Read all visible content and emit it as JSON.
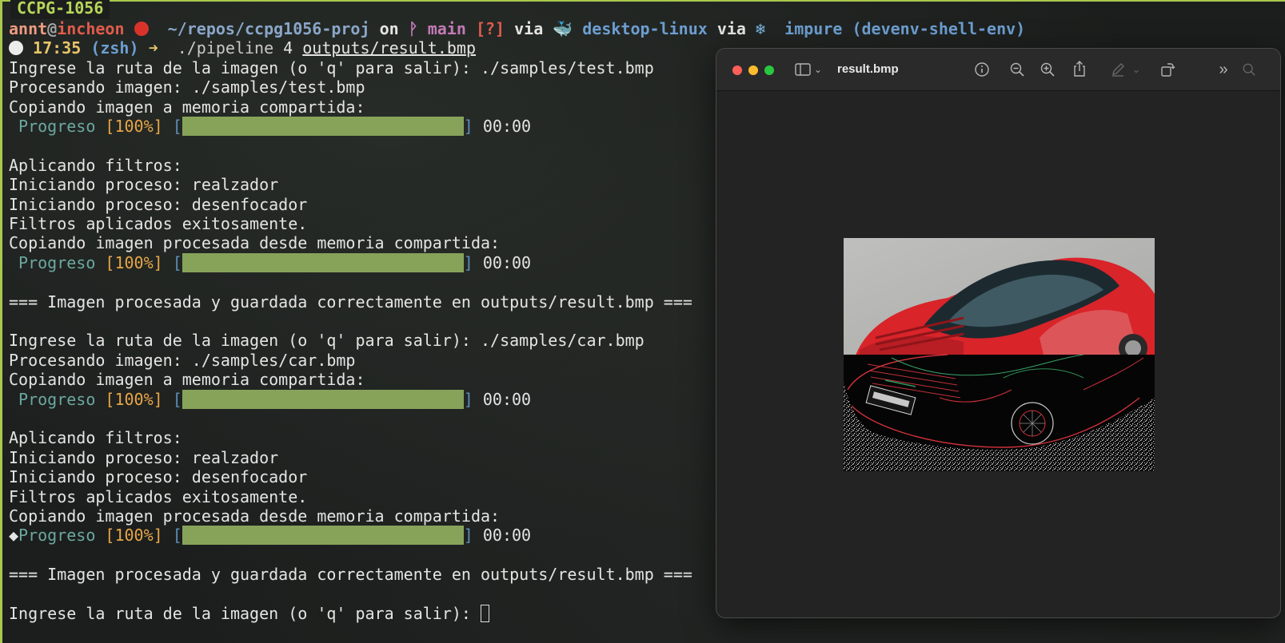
{
  "terminal": {
    "tab_title": "CCPG-1056",
    "prompt1": {
      "user": "annt",
      "at": "@",
      "host": "incheon",
      "path": "~/repos/ccpg1056-proj",
      "on": " on ",
      "branch": "main",
      "status": "[?]",
      "via1": " via ",
      "context": "desktop-linux",
      "via2": " via ",
      "env": "impure (devenv-shell-env)"
    },
    "prompt2": {
      "time": "17:35",
      "shell": "(zsh)",
      "arrow": "➜",
      "cmd": "./pipeline",
      "arg1": " 4 ",
      "arg2": "outputs/result.bmp"
    },
    "progress_label": "Progreso",
    "progress_pct": "[100%]",
    "progress_open": "[",
    "progress_close": "]",
    "progress_time": "00:00",
    "progress_value": 1.0,
    "lines": {
      "l3": "Ingrese la ruta de la imagen (o 'q' para salir): ./samples/test.bmp",
      "l4": "Procesando imagen: ./samples/test.bmp",
      "l5": "Copiando imagen a memoria compartida:",
      "l8": "Aplicando filtros:",
      "l9": "Iniciando proceso: realzador",
      "l10": "Iniciando proceso: desenfocador",
      "l11": "Filtros aplicados exitosamente.",
      "l12": "Copiando imagen procesada desde memoria compartida:",
      "l15": "=== Imagen procesada y guardada correctamente en outputs/result.bmp ===",
      "l17": "Ingrese la ruta de la imagen (o 'q' para salir): ./samples/car.bmp",
      "l18": "Procesando imagen: ./samples/car.bmp",
      "l19": "Copiando imagen a memoria compartida:",
      "l22": "Aplicando filtros:",
      "l23": "Iniciando proceso: realzador",
      "l24": "Iniciando proceso: desenfocador",
      "l25": "Filtros aplicados exitosamente.",
      "l26": "Copiando imagen procesada desde memoria compartida:",
      "l27_prefix": "◆",
      "l29": "=== Imagen procesada y guardada correctamente en outputs/result.bmp ===",
      "l31": "Ingrese la ruta de la imagen (o 'q' para salir): "
    }
  },
  "preview": {
    "title": "result.bmp",
    "icons": [
      "sidebar-icon",
      "chevron-down-icon",
      "info-icon",
      "zoom-out-icon",
      "zoom-in-icon",
      "share-icon",
      "markup-icon",
      "chevron-down-icon",
      "rotate-icon",
      "more-icon",
      "search-icon"
    ]
  },
  "colors": {
    "border": "#a9c84d",
    "progress_bar": "#87a35a"
  }
}
